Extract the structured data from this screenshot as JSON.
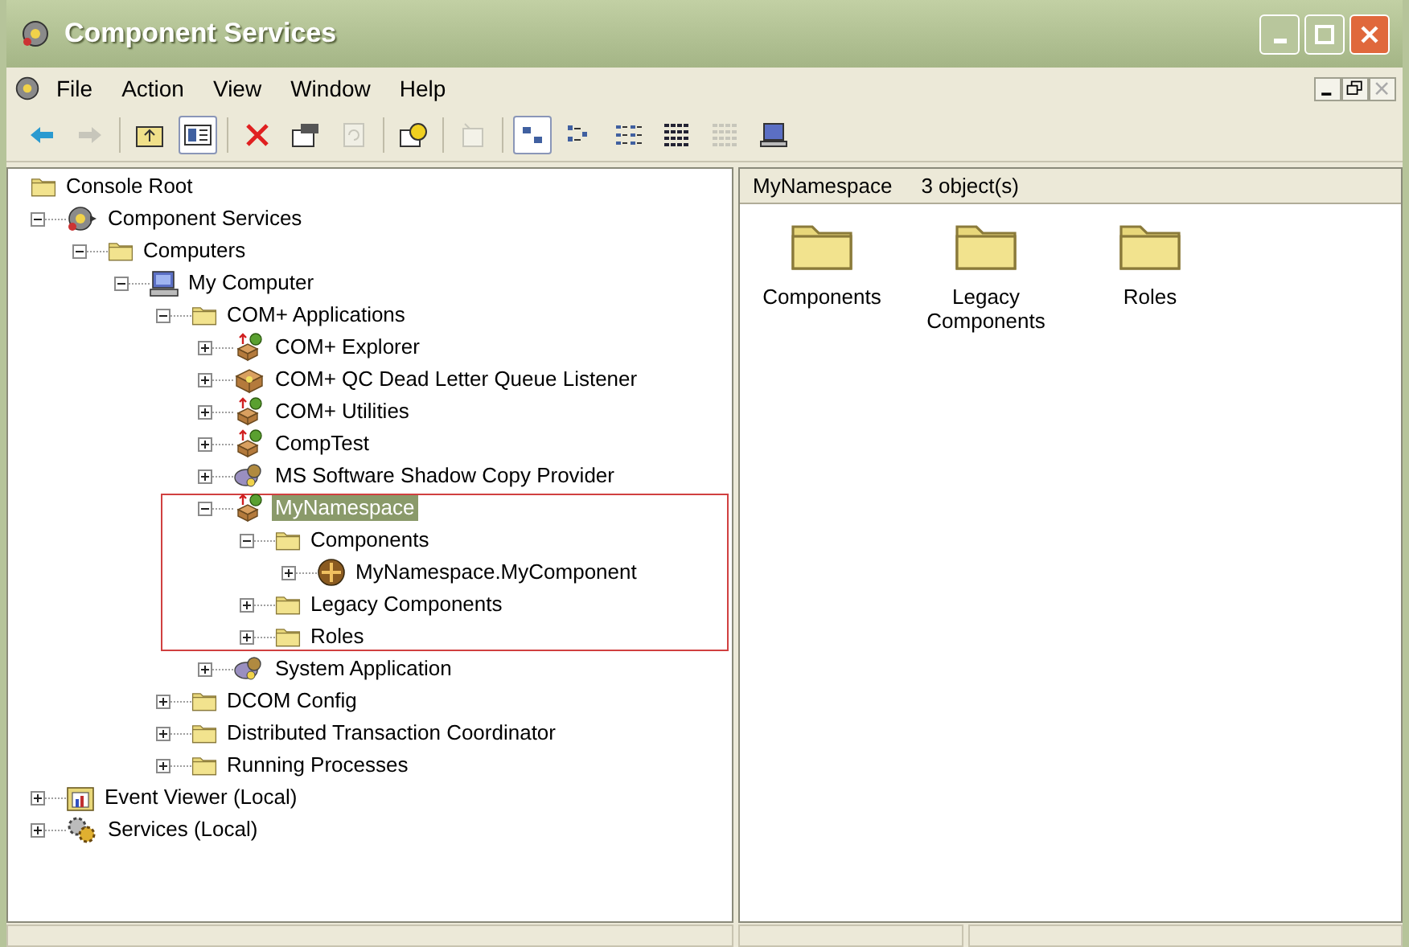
{
  "window": {
    "title": "Component Services"
  },
  "menu": [
    {
      "label": "File"
    },
    {
      "label": "Action"
    },
    {
      "label": "View"
    },
    {
      "label": "Window"
    },
    {
      "label": "Help"
    }
  ],
  "toolbar": [
    {
      "kind": "back",
      "disabled": false,
      "pressed": false
    },
    {
      "kind": "forward",
      "disabled": true,
      "pressed": false
    },
    {
      "kind": "separator"
    },
    {
      "kind": "up",
      "disabled": false,
      "pressed": false
    },
    {
      "kind": "tree",
      "disabled": false,
      "pressed": true
    },
    {
      "kind": "separator"
    },
    {
      "kind": "delete",
      "disabled": false,
      "pressed": false
    },
    {
      "kind": "properties",
      "disabled": false,
      "pressed": false
    },
    {
      "kind": "refresh",
      "disabled": true,
      "pressed": false
    },
    {
      "kind": "separator"
    },
    {
      "kind": "help",
      "disabled": false,
      "pressed": false
    },
    {
      "kind": "separator"
    },
    {
      "kind": "new",
      "disabled": true,
      "pressed": false
    },
    {
      "kind": "separator"
    },
    {
      "kind": "largeicons",
      "disabled": false,
      "pressed": true
    },
    {
      "kind": "smallicons",
      "disabled": false,
      "pressed": false
    },
    {
      "kind": "list",
      "disabled": false,
      "pressed": false
    },
    {
      "kind": "details",
      "disabled": false,
      "pressed": false
    },
    {
      "kind": "details2",
      "disabled": true,
      "pressed": false
    },
    {
      "kind": "computer",
      "disabled": false,
      "pressed": false
    }
  ],
  "tree": {
    "label": "Console Root",
    "kind": "folder",
    "selected": false,
    "highlighted": false,
    "children": [
      {
        "label": "Component Services",
        "kind": "services-snapin",
        "expanded": true,
        "selected": false,
        "highlighted": false,
        "children": [
          {
            "label": "Computers",
            "kind": "folder",
            "expanded": true,
            "selected": false,
            "highlighted": false,
            "children": [
              {
                "label": "My Computer",
                "kind": "computer",
                "expanded": true,
                "selected": false,
                "highlighted": false,
                "children": [
                  {
                    "label": "COM+ Applications",
                    "kind": "folder",
                    "expanded": true,
                    "selected": false,
                    "highlighted": false,
                    "children": [
                      {
                        "label": "COM+ Explorer",
                        "kind": "app",
                        "expanded": false,
                        "selected": false,
                        "highlighted": false
                      },
                      {
                        "label": "COM+ QC Dead Letter Queue Listener",
                        "kind": "box-app",
                        "expanded": false,
                        "selected": false,
                        "highlighted": false
                      },
                      {
                        "label": "COM+ Utilities",
                        "kind": "app",
                        "expanded": false,
                        "selected": false,
                        "highlighted": false
                      },
                      {
                        "label": "CompTest",
                        "kind": "app",
                        "expanded": false,
                        "selected": false,
                        "highlighted": false
                      },
                      {
                        "label": "MS Software Shadow Copy Provider",
                        "kind": "system-app",
                        "expanded": false,
                        "selected": false,
                        "highlighted": false
                      },
                      {
                        "label": "MyNamespace",
                        "kind": "app",
                        "expanded": true,
                        "selected": true,
                        "highlighted": true,
                        "children": [
                          {
                            "label": "Components",
                            "kind": "folder",
                            "expanded": true,
                            "selected": false,
                            "highlighted": false,
                            "children": [
                              {
                                "label": "MyNamespace.MyComponent",
                                "kind": "component",
                                "expanded": false,
                                "selected": false,
                                "highlighted": false
                              }
                            ]
                          },
                          {
                            "label": "Legacy Components",
                            "kind": "folder",
                            "expanded": false,
                            "selected": false,
                            "highlighted": false
                          },
                          {
                            "label": "Roles",
                            "kind": "folder",
                            "expanded": false,
                            "selected": false,
                            "highlighted": false
                          }
                        ]
                      },
                      {
                        "label": "System Application",
                        "kind": "system-app",
                        "expanded": false,
                        "selected": false,
                        "highlighted": false
                      }
                    ]
                  },
                  {
                    "label": "DCOM Config",
                    "kind": "folder",
                    "expanded": false,
                    "selected": false,
                    "highlighted": false
                  },
                  {
                    "label": "Distributed Transaction Coordinator",
                    "kind": "folder",
                    "expanded": false,
                    "selected": false,
                    "highlighted": false
                  },
                  {
                    "label": "Running Processes",
                    "kind": "folder",
                    "expanded": false,
                    "selected": false,
                    "highlighted": false
                  }
                ]
              }
            ]
          }
        ]
      },
      {
        "label": "Event Viewer (Local)",
        "kind": "event-viewer",
        "expanded": false,
        "selected": false,
        "highlighted": false
      },
      {
        "label": "Services (Local)",
        "kind": "gears",
        "expanded": false,
        "selected": false,
        "highlighted": false
      }
    ]
  },
  "details": {
    "title": "MyNamespace",
    "count": "3 object(s)",
    "items": [
      {
        "label": "Components"
      },
      {
        "label": "Legacy Components"
      },
      {
        "label": "Roles"
      }
    ]
  }
}
